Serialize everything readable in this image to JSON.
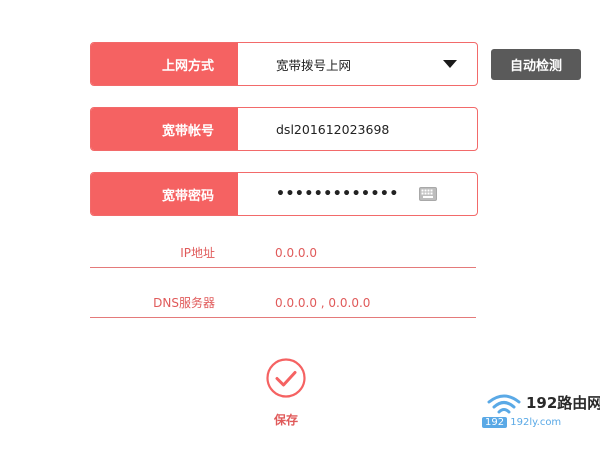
{
  "form": {
    "connection_type": {
      "label": "上网方式",
      "value": "宽带拨号上网"
    },
    "account": {
      "label": "宽带帐号",
      "value": "dsl201612023698"
    },
    "password": {
      "label": "宽带密码",
      "value": "•••••••••••••"
    },
    "auto_detect_label": "自动检测"
  },
  "status": {
    "ip": {
      "label": "IP地址",
      "value": "0.0.0.0"
    },
    "dns": {
      "label": "DNS服务器",
      "value": "0.0.0.0 , 0.0.0.0"
    }
  },
  "save_label": "保存",
  "watermark": {
    "title": "192路由网",
    "sub_num": "192",
    "sub_site": "192ly.com"
  },
  "colors": {
    "accent": "#f56262",
    "button_dark": "#5a5a5a",
    "watermark_blue": "#5aa9e6"
  },
  "icons": {
    "dropdown": "chevron-down-icon",
    "keyboard": "keyboard-icon",
    "save": "check-circle-icon",
    "wifi": "wifi-icon"
  }
}
